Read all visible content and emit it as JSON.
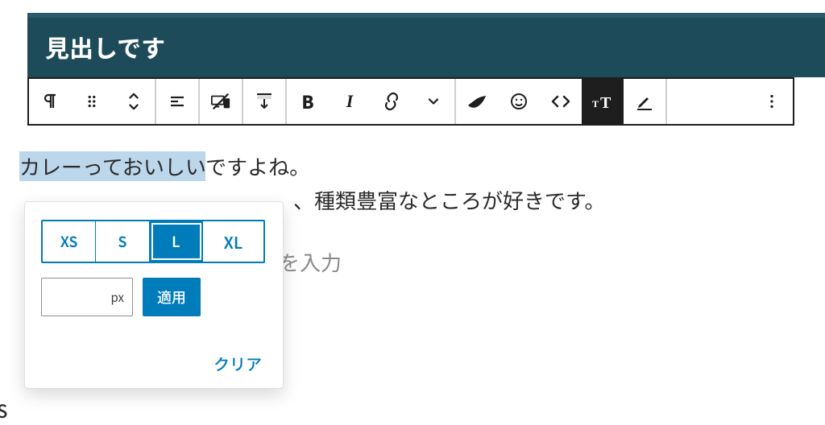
{
  "heading": "見出しです",
  "paragraph1": {
    "highlighted": "カレーっておいしい",
    "rest": "ですよね。"
  },
  "paragraph2": "、種類豊富なところが好きです。",
  "placeholder_tail": "を入力",
  "toolbar": {
    "block_type_icon": "pilcrow-icon",
    "move_icon": "drag-handle-icon",
    "updown_icon": "move-updown-icon",
    "align_icon": "align-left-icon",
    "device_icon": "device-visibility-icon",
    "spacer_icon": "spacer-icon",
    "bold_letter": "B",
    "italic_letter": "I",
    "link_icon": "link-icon",
    "chevron_icon": "chevron-down-icon",
    "brush_icon": "brush-icon",
    "emoji_icon": "emoji-icon",
    "code_icon": "code-icon",
    "fontsize_icon": "font-size-icon",
    "highlight_icon": "highlighter-icon",
    "more_icon": "more-options-icon"
  },
  "popover": {
    "sizes": [
      "XS",
      "S",
      "L",
      "XL"
    ],
    "selected_index": 2,
    "px_unit": "px",
    "apply": "適用",
    "clear": "クリア"
  },
  "stray_bottom": "S"
}
